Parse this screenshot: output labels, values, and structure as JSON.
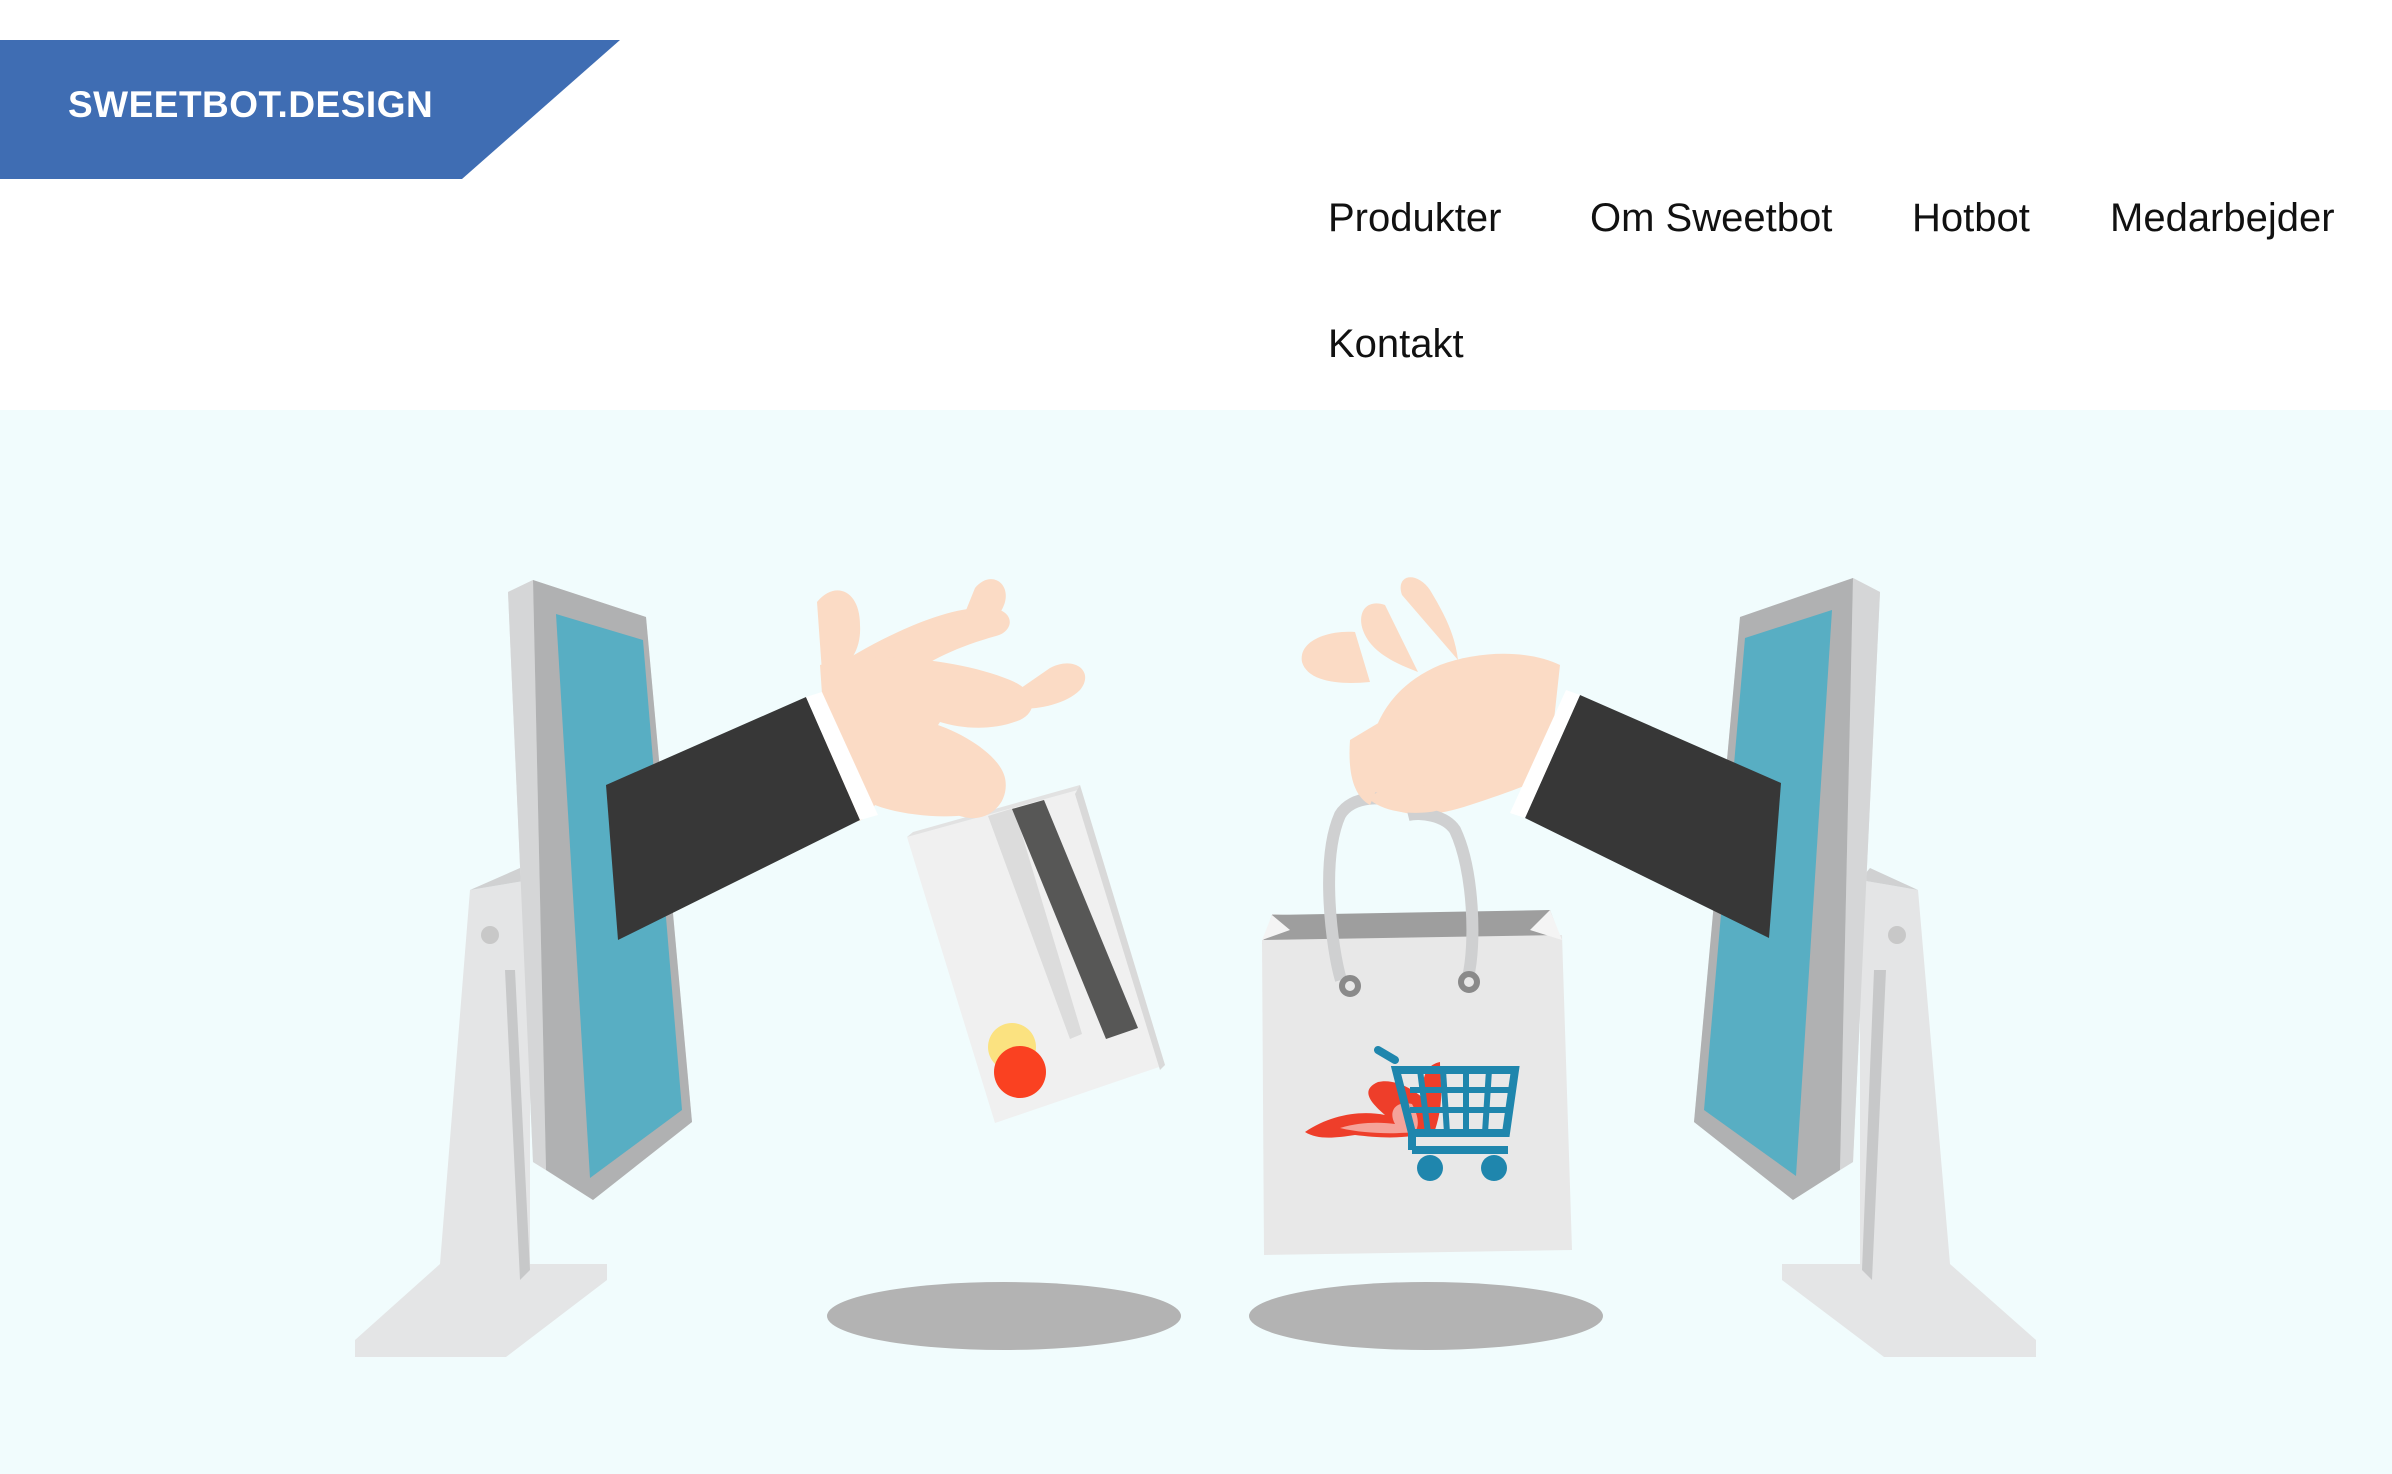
{
  "site": {
    "logo_text": "SWEETBOT.DESIGN",
    "brand_color": "#3f6db3"
  },
  "nav": {
    "items": [
      {
        "label": "Produkter"
      },
      {
        "label": "Om Sweetbot"
      },
      {
        "label": "Hotbot"
      },
      {
        "label": "Medarbejder"
      },
      {
        "label": "Kontakt"
      }
    ]
  },
  "hero": {
    "illustration": "online-shopping-illustration",
    "background_color": "#f1fcfd",
    "icons": [
      "monitor-icon",
      "hand-icon",
      "credit-card-icon",
      "shopping-bag-icon",
      "shopping-cart-icon",
      "flame-icon"
    ]
  }
}
